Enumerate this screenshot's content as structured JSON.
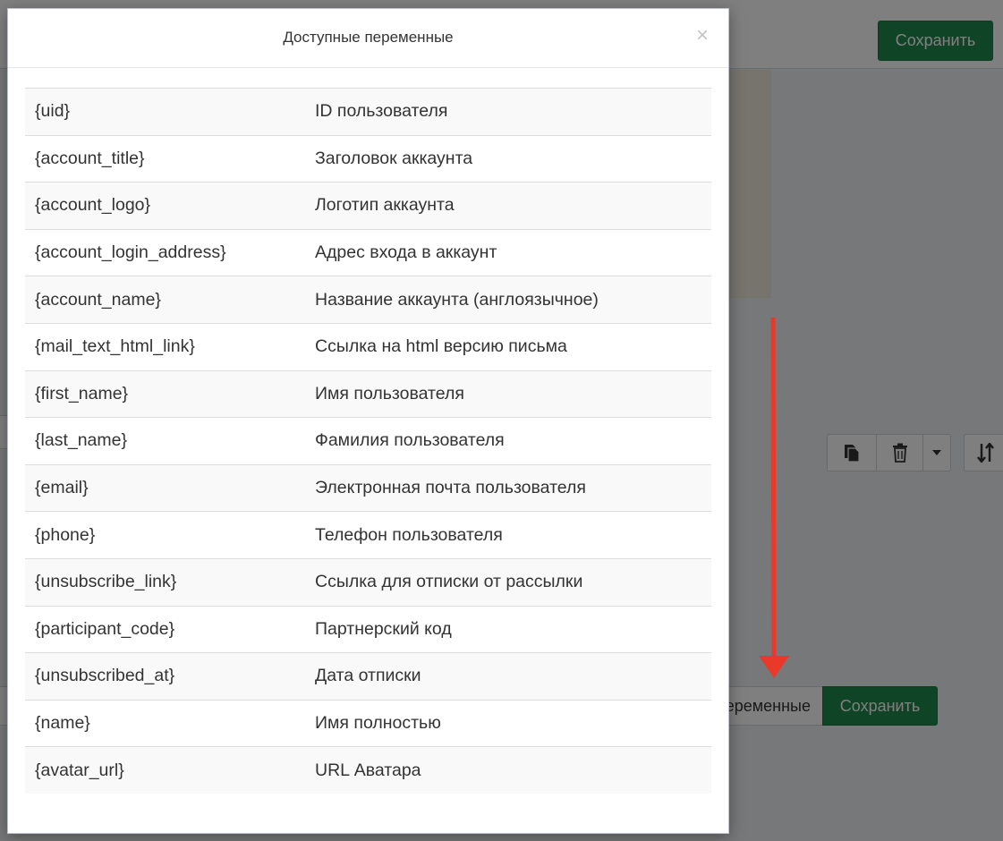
{
  "background": {
    "header_save_label": "Сохранить",
    "variables_button_label": "Переменные",
    "footer_save_label": "Сохранить",
    "icons": [
      "copy-icon",
      "trash-icon",
      "caret-down-icon",
      "sort-icon"
    ],
    "accent_color": "#1f8a4c"
  },
  "modal": {
    "title": "Доступные переменные",
    "close_symbol": "×",
    "variables": [
      {
        "key": "{uid}",
        "description": "ID пользователя"
      },
      {
        "key": "{account_title}",
        "description": "Заголовок аккаунта"
      },
      {
        "key": "{account_logo}",
        "description": "Логотип аккаунта"
      },
      {
        "key": "{account_login_address}",
        "description": "Адрес входа в аккаунт"
      },
      {
        "key": "{account_name}",
        "description": "Название аккаунта (англоязычное)"
      },
      {
        "key": "{mail_text_html_link}",
        "description": "Ссылка на html версию письма"
      },
      {
        "key": "{first_name}",
        "description": "Имя пользователя"
      },
      {
        "key": "{last_name}",
        "description": "Фамилия пользователя"
      },
      {
        "key": "{email}",
        "description": "Электронная почта пользователя"
      },
      {
        "key": "{phone}",
        "description": "Телефон пользователя"
      },
      {
        "key": "{unsubscribe_link}",
        "description": "Ссылка для отписки от рассылки"
      },
      {
        "key": "{participant_code}",
        "description": "Партнерский код"
      },
      {
        "key": "{unsubscribed_at}",
        "description": "Дата отписки"
      },
      {
        "key": "{name}",
        "description": "Имя полностью"
      },
      {
        "key": "{avatar_url}",
        "description": "URL Аватара"
      }
    ]
  },
  "annotation": {
    "arrow_color": "#e8392b"
  }
}
